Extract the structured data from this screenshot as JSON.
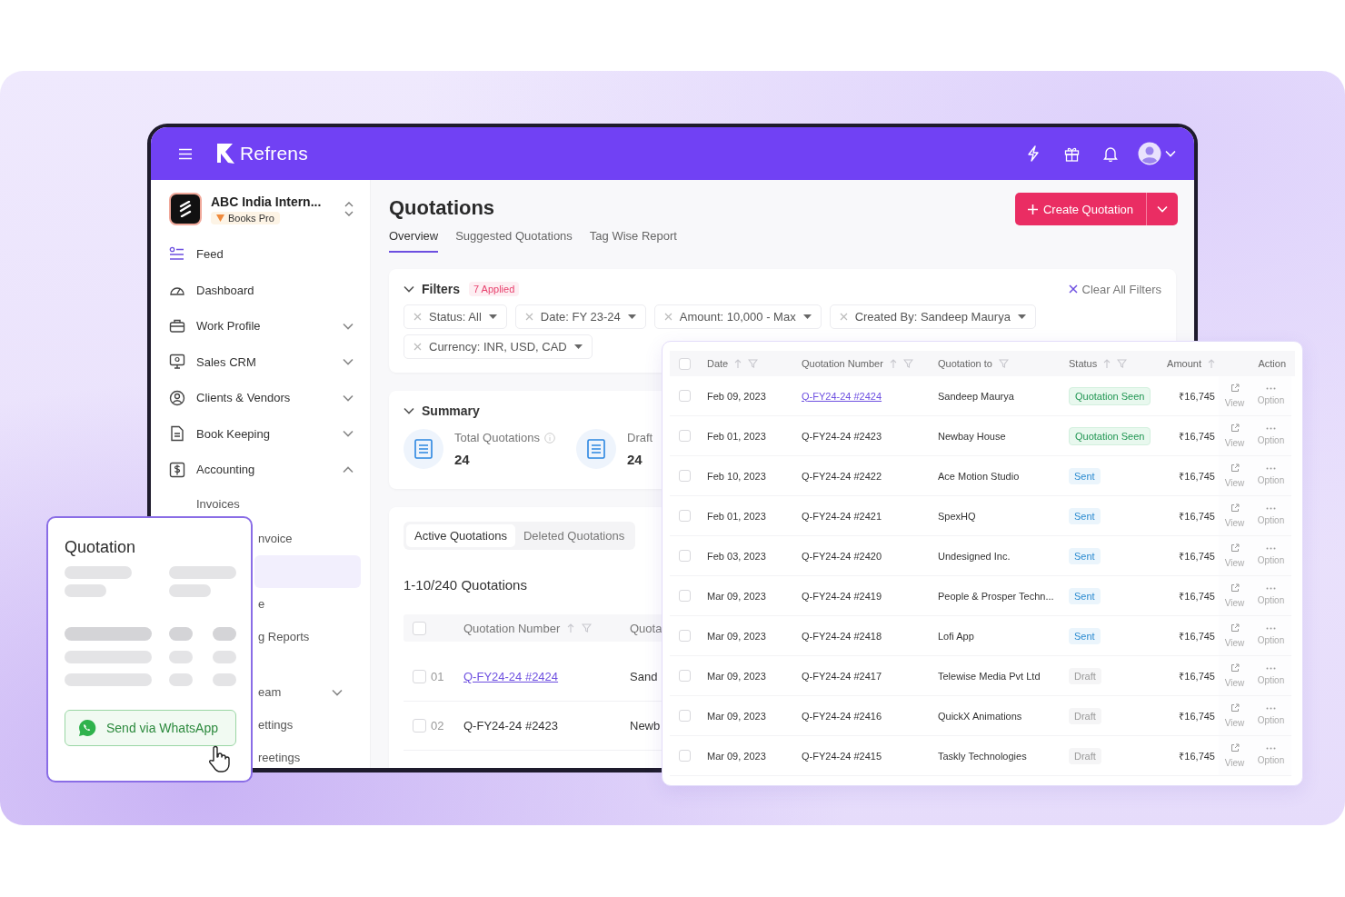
{
  "header": {
    "logo_text": "Refrens"
  },
  "sidebar": {
    "org": {
      "name": "ABC India Intern...",
      "plan": "Books Pro"
    },
    "items": [
      {
        "label": "Feed",
        "kind": "link"
      },
      {
        "label": "Dashboard",
        "kind": "link"
      },
      {
        "label": "Work Profile",
        "kind": "group",
        "expanded": false
      },
      {
        "label": "Sales CRM",
        "kind": "group",
        "expanded": false
      },
      {
        "label": "Clients & Vendors",
        "kind": "group",
        "expanded": false
      },
      {
        "label": "Book Keeping",
        "kind": "group",
        "expanded": false
      },
      {
        "label": "Accounting",
        "kind": "group",
        "expanded": true,
        "children": [
          {
            "label": "Invoices",
            "kind": "link",
            "selected": false
          },
          {
            "label": "nvoice",
            "kind": "link",
            "selected": false
          },
          {
            "kind": "link",
            "selected": true
          },
          {
            "label": "e",
            "kind": "link",
            "selected": false
          },
          {
            "label": "g Reports",
            "kind": "link",
            "selected": false
          },
          {
            "label": "eam",
            "kind": "group",
            "expanded": false,
            "selected": false
          },
          {
            "label": "ettings",
            "kind": "link",
            "selected": false
          },
          {
            "label": "reetings",
            "kind": "link",
            "selected": false
          }
        ]
      }
    ]
  },
  "main": {
    "title": "Quotations",
    "create_button": "Create Quotation",
    "tabs": [
      {
        "label": "Overview",
        "selected": true
      },
      {
        "label": "Suggested Quotations",
        "selected": false
      },
      {
        "label": "Tag Wise Report",
        "selected": false
      }
    ],
    "filters": {
      "title": "Filters",
      "expanded": true,
      "badge": "7 Applied",
      "clear": "Clear All Filters",
      "chips": [
        "Status: All",
        "Date: FY 23-24",
        "Amount: 10,000 - Max",
        "Created By: Sandeep Maurya",
        "Currency: INR, USD, CAD"
      ]
    },
    "summary": {
      "title": "Summary",
      "expanded": true,
      "stats": [
        {
          "label": "Total Quotations",
          "value": "24",
          "info": true
        },
        {
          "label": "Draft",
          "value": "24",
          "info": false
        }
      ]
    },
    "list": {
      "tabs": [
        {
          "label": "Active Quotations",
          "selected": true
        },
        {
          "label": "Deleted Quotations",
          "selected": false
        }
      ],
      "count": "1-10/240 Quotations",
      "all_checked": false,
      "columns": [
        {
          "label": "Quotation Number",
          "sortable": true,
          "filterable": true
        },
        {
          "label": "Quota"
        }
      ],
      "rows": [
        {
          "index": "01",
          "number": "Q-FY24-24 #2424",
          "link": true,
          "client": "Sand",
          "checked": false
        },
        {
          "index": "02",
          "number": "Q-FY24-24 #2423",
          "link": false,
          "client": "Newb",
          "checked": false
        }
      ]
    }
  },
  "table_card": {
    "all_checked": false,
    "columns": [
      {
        "label": "Date",
        "sortable": true,
        "filterable": true
      },
      {
        "label": "Quotation Number",
        "sortable": true,
        "filterable": true
      },
      {
        "label": "Quotation to",
        "sortable": false,
        "filterable": true
      },
      {
        "label": "Status",
        "sortable": true,
        "filterable": true
      },
      {
        "label": "Amount",
        "sortable": true,
        "filterable": false
      },
      {
        "label": "Action",
        "sortable": false,
        "filterable": false
      }
    ],
    "rows": [
      {
        "date": "Feb 09, 2023",
        "number": "Q-FY24-24 #2424",
        "link": true,
        "client": "Sandeep Maurya",
        "status": "Quotation Seen",
        "kind": "seen",
        "amount": "₹16,745",
        "actions": [
          "View",
          "Option"
        ],
        "checked": false
      },
      {
        "date": "Feb 01, 2023",
        "number": "Q-FY24-24 #2423",
        "link": false,
        "client": "Newbay House",
        "status": "Quotation Seen",
        "kind": "seen",
        "amount": "₹16,745",
        "actions": [
          "View",
          "Option"
        ],
        "checked": false
      },
      {
        "date": "Feb 10, 2023",
        "number": "Q-FY24-24 #2422",
        "link": false,
        "client": "Ace Motion Studio",
        "status": "Sent",
        "kind": "sent",
        "amount": "₹16,745",
        "actions": [
          "View",
          "Option"
        ],
        "checked": false
      },
      {
        "date": "Feb 01, 2023",
        "number": "Q-FY24-24 #2421",
        "link": false,
        "client": "SpexHQ",
        "status": "Sent",
        "kind": "sent",
        "amount": "₹16,745",
        "actions": [
          "View",
          "Option"
        ],
        "checked": false
      },
      {
        "date": "Feb 03, 2023",
        "number": "Q-FY24-24 #2420",
        "link": false,
        "client": "Undesigned Inc.",
        "status": "Sent",
        "kind": "sent",
        "amount": "₹16,745",
        "actions": [
          "View",
          "Option"
        ],
        "checked": false
      },
      {
        "date": "Mar 09, 2023",
        "number": "Q-FY24-24 #2419",
        "link": false,
        "client": "People & Prosper Techn...",
        "status": "Sent",
        "kind": "sent",
        "amount": "₹16,745",
        "actions": [
          "View",
          "Option"
        ],
        "checked": false
      },
      {
        "date": "Mar 09, 2023",
        "number": "Q-FY24-24 #2418",
        "link": false,
        "client": "Lofi App",
        "status": "Sent",
        "kind": "sent",
        "amount": "₹16,745",
        "actions": [
          "View",
          "Option"
        ],
        "checked": false
      },
      {
        "date": "Mar 09, 2023",
        "number": "Q-FY24-24 #2417",
        "link": false,
        "client": "Telewise Media Pvt Ltd",
        "status": "Draft",
        "kind": "draft",
        "amount": "₹16,745",
        "actions": [
          "View",
          "Option"
        ],
        "checked": false
      },
      {
        "date": "Mar 09, 2023",
        "number": "Q-FY24-24 #2416",
        "link": false,
        "client": "QuickX Animations",
        "status": "Draft",
        "kind": "draft",
        "amount": "₹16,745",
        "actions": [
          "View",
          "Option"
        ],
        "checked": false
      },
      {
        "date": "Mar 09, 2023",
        "number": "Q-FY24-24 #2415",
        "link": false,
        "client": "Taskly Technologies",
        "status": "Draft",
        "kind": "draft",
        "amount": "₹16,745",
        "actions": [
          "View",
          "Option"
        ],
        "checked": false
      }
    ]
  },
  "quote_card": {
    "title": "Quotation",
    "button": "Send via WhatsApp"
  }
}
